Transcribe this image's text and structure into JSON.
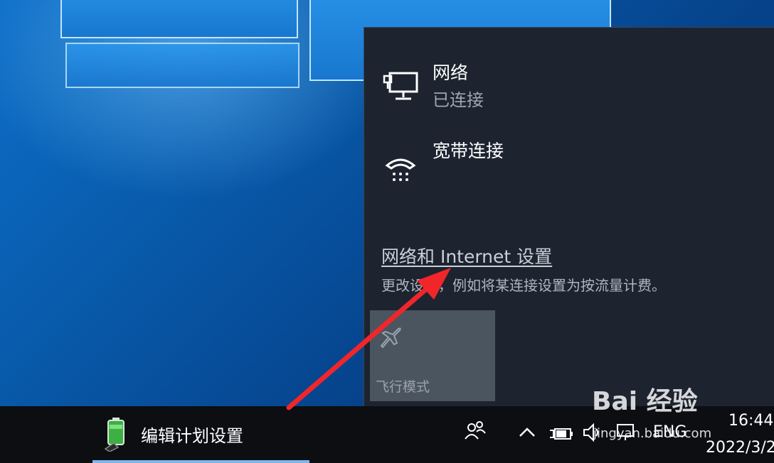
{
  "flyout": {
    "network": {
      "title": "网络",
      "status": "已连接",
      "icon": "ethernet-monitor-icon"
    },
    "broadband": {
      "title": "宽带连接",
      "icon": "dialup-phone-icon"
    },
    "settings_link": "网络和 Internet 设置",
    "settings_desc": "更改设置，例如将某连接设置为按流量计费。",
    "airplane": {
      "label": "飞行模式",
      "icon": "airplane-icon"
    }
  },
  "taskbar": {
    "app_label": "编辑计划设置",
    "app_icon": "battery-plug-icon",
    "tray_icons": [
      "people-icon",
      "chevron-up-icon",
      "power-icon",
      "volume-icon",
      "network-icon"
    ],
    "language": "ENG",
    "time": "16:44",
    "date": "2022/3/2"
  },
  "watermark": {
    "brand": "Bai 经验",
    "url": "jingyan.baidu.com"
  },
  "colors": {
    "arrow": "#f0262b",
    "flyout_bg": "#1d2430",
    "taskbar_bg": "#0c0e12",
    "accent": "#7fb6ea"
  }
}
